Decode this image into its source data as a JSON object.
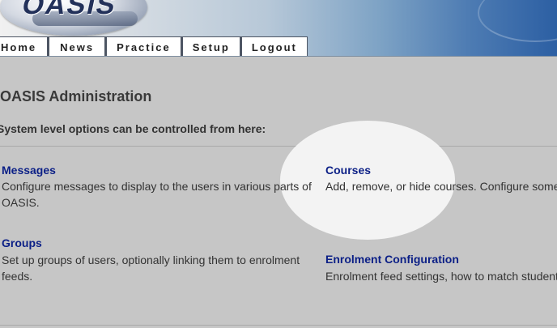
{
  "header": {
    "logo_text": "OASIS"
  },
  "nav": {
    "tabs": [
      {
        "label": "Home"
      },
      {
        "label": "News"
      },
      {
        "label": "Practice"
      },
      {
        "label": "Setup"
      },
      {
        "label": "Logout"
      }
    ]
  },
  "main": {
    "title": "OASIS Administration",
    "intro": "System level options can be controlled from here:",
    "options": [
      {
        "label": "Messages",
        "description": "Configure messages to display to the users in various parts of OASIS."
      },
      {
        "label": "Groups",
        "description": "Set up groups of users, optionally linking them to enrolment feeds."
      },
      {
        "label": "Courses",
        "description": "Add, remove, or hide courses. Configure some course settings."
      },
      {
        "label": "Enrolment Configuration",
        "description": "Enrolment feed settings, how to match students to courses."
      }
    ]
  },
  "colors": {
    "link": "#0b1f86",
    "background": "#c6c6c6",
    "highlight": "#f3f3f3"
  }
}
